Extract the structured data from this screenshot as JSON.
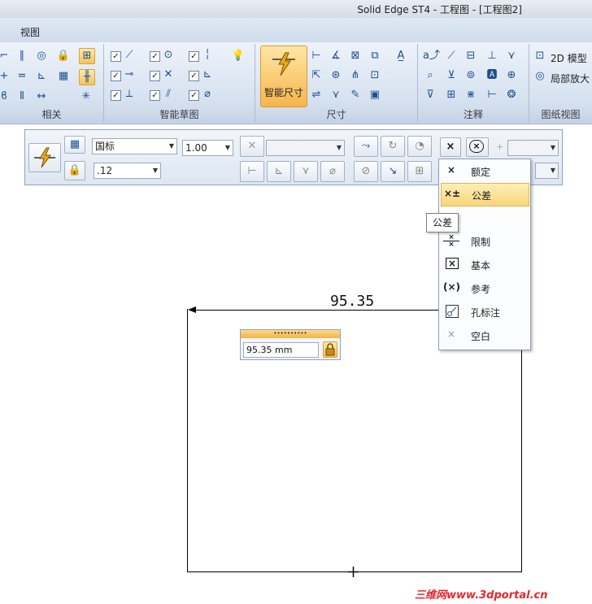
{
  "window": {
    "title": "Solid Edge ST4 - 工程图 - [工程图2]"
  },
  "tabs": [
    {
      "label": "视图"
    }
  ],
  "ribbon": {
    "groups": [
      {
        "label": "相关"
      },
      {
        "label": "智能草图"
      },
      {
        "label": "尺寸"
      },
      {
        "label": "注释"
      },
      {
        "label": "图纸视图"
      }
    ],
    "smart_dimension_label": "智能尺寸",
    "view_items": [
      {
        "label": "2D 模型"
      },
      {
        "label": "局部放大"
      }
    ]
  },
  "command_bar": {
    "standard": "国标",
    "scale": "1.00",
    "precision": ".12",
    "type_code_icon": "×"
  },
  "dimension_type_menu": {
    "items": [
      {
        "label": "额定",
        "icon": "×"
      },
      {
        "label": "公差",
        "icon": "×±"
      },
      {
        "label": "",
        "icon": "±"
      },
      {
        "label": "限制",
        "icon": "×/×"
      },
      {
        "label": "基本",
        "icon": "[×]"
      },
      {
        "label": "参考",
        "icon": "(×)"
      },
      {
        "label": "孔标注",
        "icon": "hole-callout-icon"
      },
      {
        "label": "空白",
        "icon": "×"
      }
    ],
    "selected": "公差",
    "tooltip": "公差"
  },
  "drawing": {
    "dimension_text": "95.35",
    "value_input": "95.35 mm"
  },
  "watermark": "三维网www.3dportal.cn",
  "colors": {
    "highlight": "#f7b54c",
    "ribbon": "#d6e2f0",
    "accent": "#1e395b"
  }
}
